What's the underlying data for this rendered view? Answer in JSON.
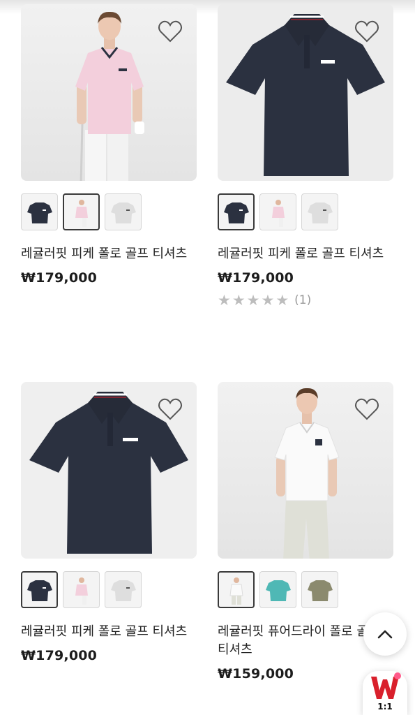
{
  "products": [
    {
      "name": "레귤러핏 피케 폴로 골프 티셔츠",
      "price": "₩179,000",
      "image": "model-pink-polo",
      "swatches": [
        "navy",
        "pink",
        "light-gray"
      ],
      "selected_swatch": 1
    },
    {
      "name": "레귤러핏 피케 폴로 골프 티셔츠",
      "price": "₩179,000",
      "image": "navy-polo-flat",
      "swatches": [
        "navy",
        "pink",
        "light-gray"
      ],
      "selected_swatch": 0,
      "rating": {
        "stars": 5,
        "count": "(1)"
      }
    },
    {
      "name": "레귤러핏 피케 폴로 골프 티셔츠",
      "price": "₩179,000",
      "image": "navy-polo-flat",
      "swatches": [
        "navy",
        "pink",
        "light-gray"
      ],
      "selected_swatch": 0
    },
    {
      "name": "레귤러핏 퓨어드라이 폴로 골프 티셔츠",
      "price": "₩159,000",
      "image": "model-white-polo",
      "swatches": [
        "white",
        "teal",
        "khaki"
      ],
      "selected_swatch": 0
    }
  ],
  "floating": {
    "scroll_top_icon": "chevron-up-icon",
    "chat_badge_label": "1:1",
    "brand_color": "#d9202c"
  },
  "colors": {
    "navy": "#2b3140",
    "pink": "#f3d4de",
    "light_gray": "#e3e3e3",
    "white": "#f7f7f7",
    "teal": "#4fb8b5",
    "khaki": "#8b8a6e"
  }
}
